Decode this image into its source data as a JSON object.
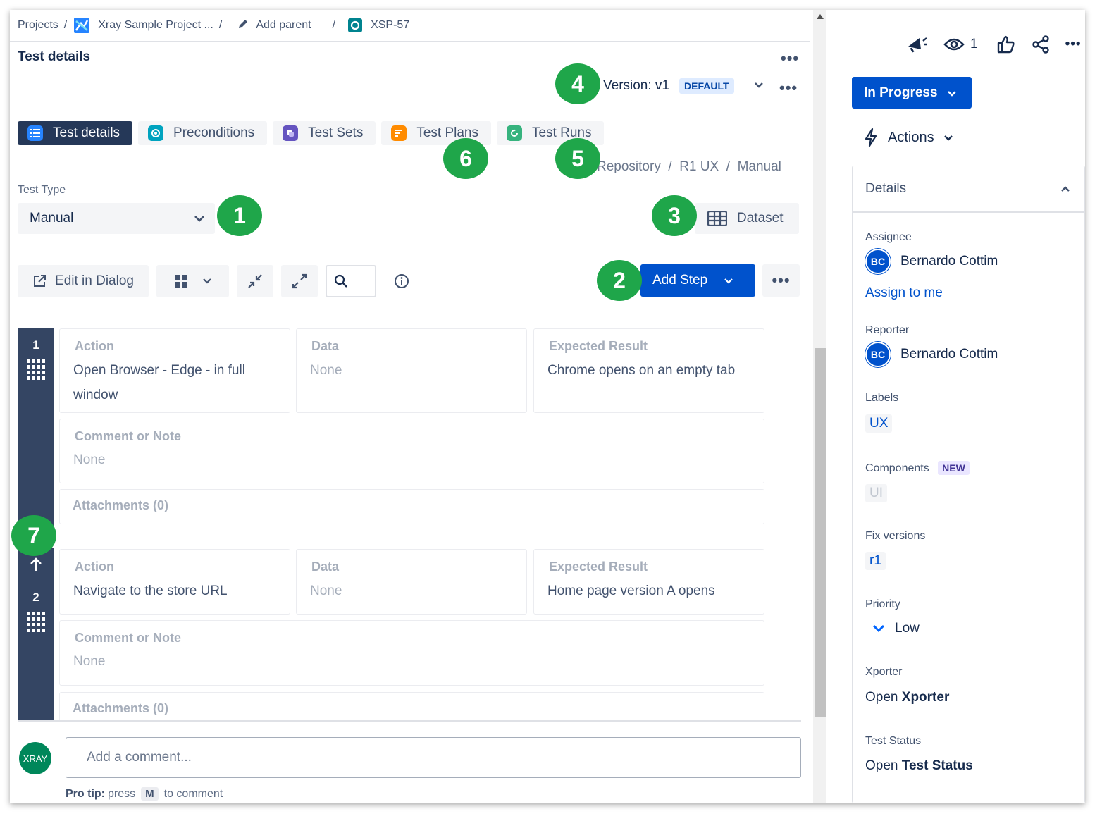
{
  "breadcrumb": {
    "projects": "Projects",
    "project": "Xray Sample Project ...",
    "add_parent": "Add parent",
    "issue_key": "XSP-57"
  },
  "section_title": "Test details",
  "version": {
    "label": "Version: v1",
    "badge": "DEFAULT"
  },
  "tabs": [
    {
      "label": "Test details",
      "active": true
    },
    {
      "label": "Preconditions"
    },
    {
      "label": "Test Sets"
    },
    {
      "label": "Test Plans"
    },
    {
      "label": "Test Runs"
    }
  ],
  "repository_path": "Repository  /  R1 UX  /  Manual",
  "test_type": {
    "label": "Test Type",
    "value": "Manual"
  },
  "dataset_label": "Dataset",
  "toolbar": {
    "edit_in_dialog": "Edit in Dialog",
    "add_step": "Add Step"
  },
  "steps": [
    {
      "number": "1",
      "action_label": "Action",
      "action": "Open Browser - Edge - in full",
      "action_line2": "window",
      "data_label": "Data",
      "data": "None",
      "expected_label": "Expected Result",
      "expected": "Chrome opens on an empty tab",
      "comment_label": "Comment or Note",
      "comment": "None",
      "attachments": "Attachments (0)"
    },
    {
      "number": "2",
      "action_label": "Action",
      "action": "Navigate to the store URL",
      "data_label": "Data",
      "data": "None",
      "expected_label": "Expected Result",
      "expected": "Home page version A opens",
      "comment_label": "Comment or Note",
      "comment": "None",
      "attachments": "Attachments (0)"
    }
  ],
  "comment": {
    "avatar": "XRAY",
    "placeholder": "Add a comment...",
    "protip_bold": "Pro tip:",
    "protip_press": "press",
    "protip_key": "M",
    "protip_end": "to comment"
  },
  "markers": [
    "1",
    "2",
    "3",
    "4",
    "5",
    "6",
    "7"
  ],
  "sidebar": {
    "watch_count": "1",
    "status": "In Progress",
    "actions": "Actions",
    "details_title": "Details",
    "assignee_label": "Assignee",
    "assignee_initials": "BC",
    "assignee": "Bernardo Cottim",
    "assign_to_me": "Assign to me",
    "reporter_label": "Reporter",
    "reporter_initials": "BC",
    "reporter": "Bernardo Cottim",
    "labels_label": "Labels",
    "labels_value": "UX",
    "components_label": "Components",
    "components_badge": "NEW",
    "components_value": "UI",
    "fix_versions_label": "Fix versions",
    "fix_versions_value": "r1",
    "priority_label": "Priority",
    "priority_value": "Low",
    "xporter_label": "Xporter",
    "xporter_open": "Open",
    "xporter_value": "Xporter",
    "test_status_label": "Test Status",
    "test_status_open": "Open",
    "test_status_value": "Test Status"
  },
  "colors": {
    "primary": "#0052cc",
    "active_tab": "#253858",
    "step_bar": "#344563",
    "marker": "#1fa64a"
  }
}
